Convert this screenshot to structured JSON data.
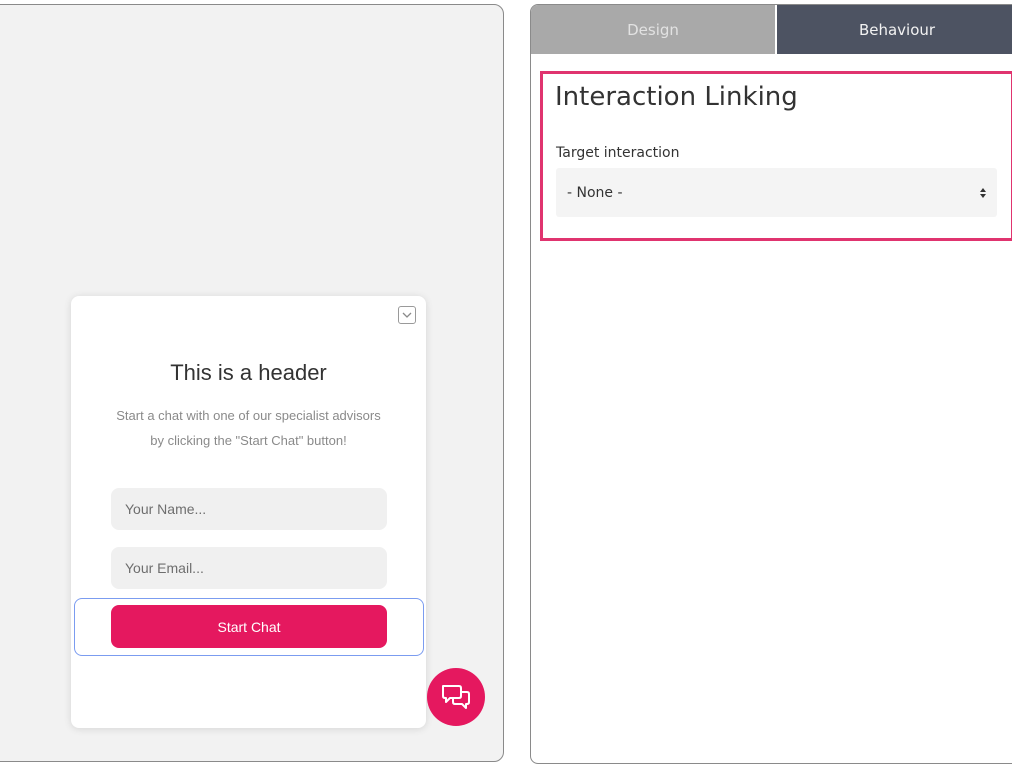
{
  "preview": {
    "card": {
      "header": "This is a header",
      "subtitle_line1": "Start a chat with one of our specialist advisors",
      "subtitle_line2": "by clicking the \"Start Chat\" button!",
      "name_placeholder": "Your Name...",
      "email_placeholder": "Your Email...",
      "start_button_label": "Start Chat",
      "minimize_icon": "chevron-down-icon"
    },
    "launcher_icon": "chat-bubbles-icon"
  },
  "settings": {
    "tabs": [
      {
        "label": "Design",
        "active": false
      },
      {
        "label": "Behaviour",
        "active": true
      }
    ],
    "section_title": "Interaction Linking",
    "target_interaction": {
      "label": "Target interaction",
      "selected": "- None -"
    }
  },
  "colors": {
    "accent": "#e5185f",
    "highlight_border": "#e0346f",
    "active_tab": "#4d5362",
    "inactive_tab": "#a9a9a9",
    "focus_ring": "#7b9cf0"
  }
}
